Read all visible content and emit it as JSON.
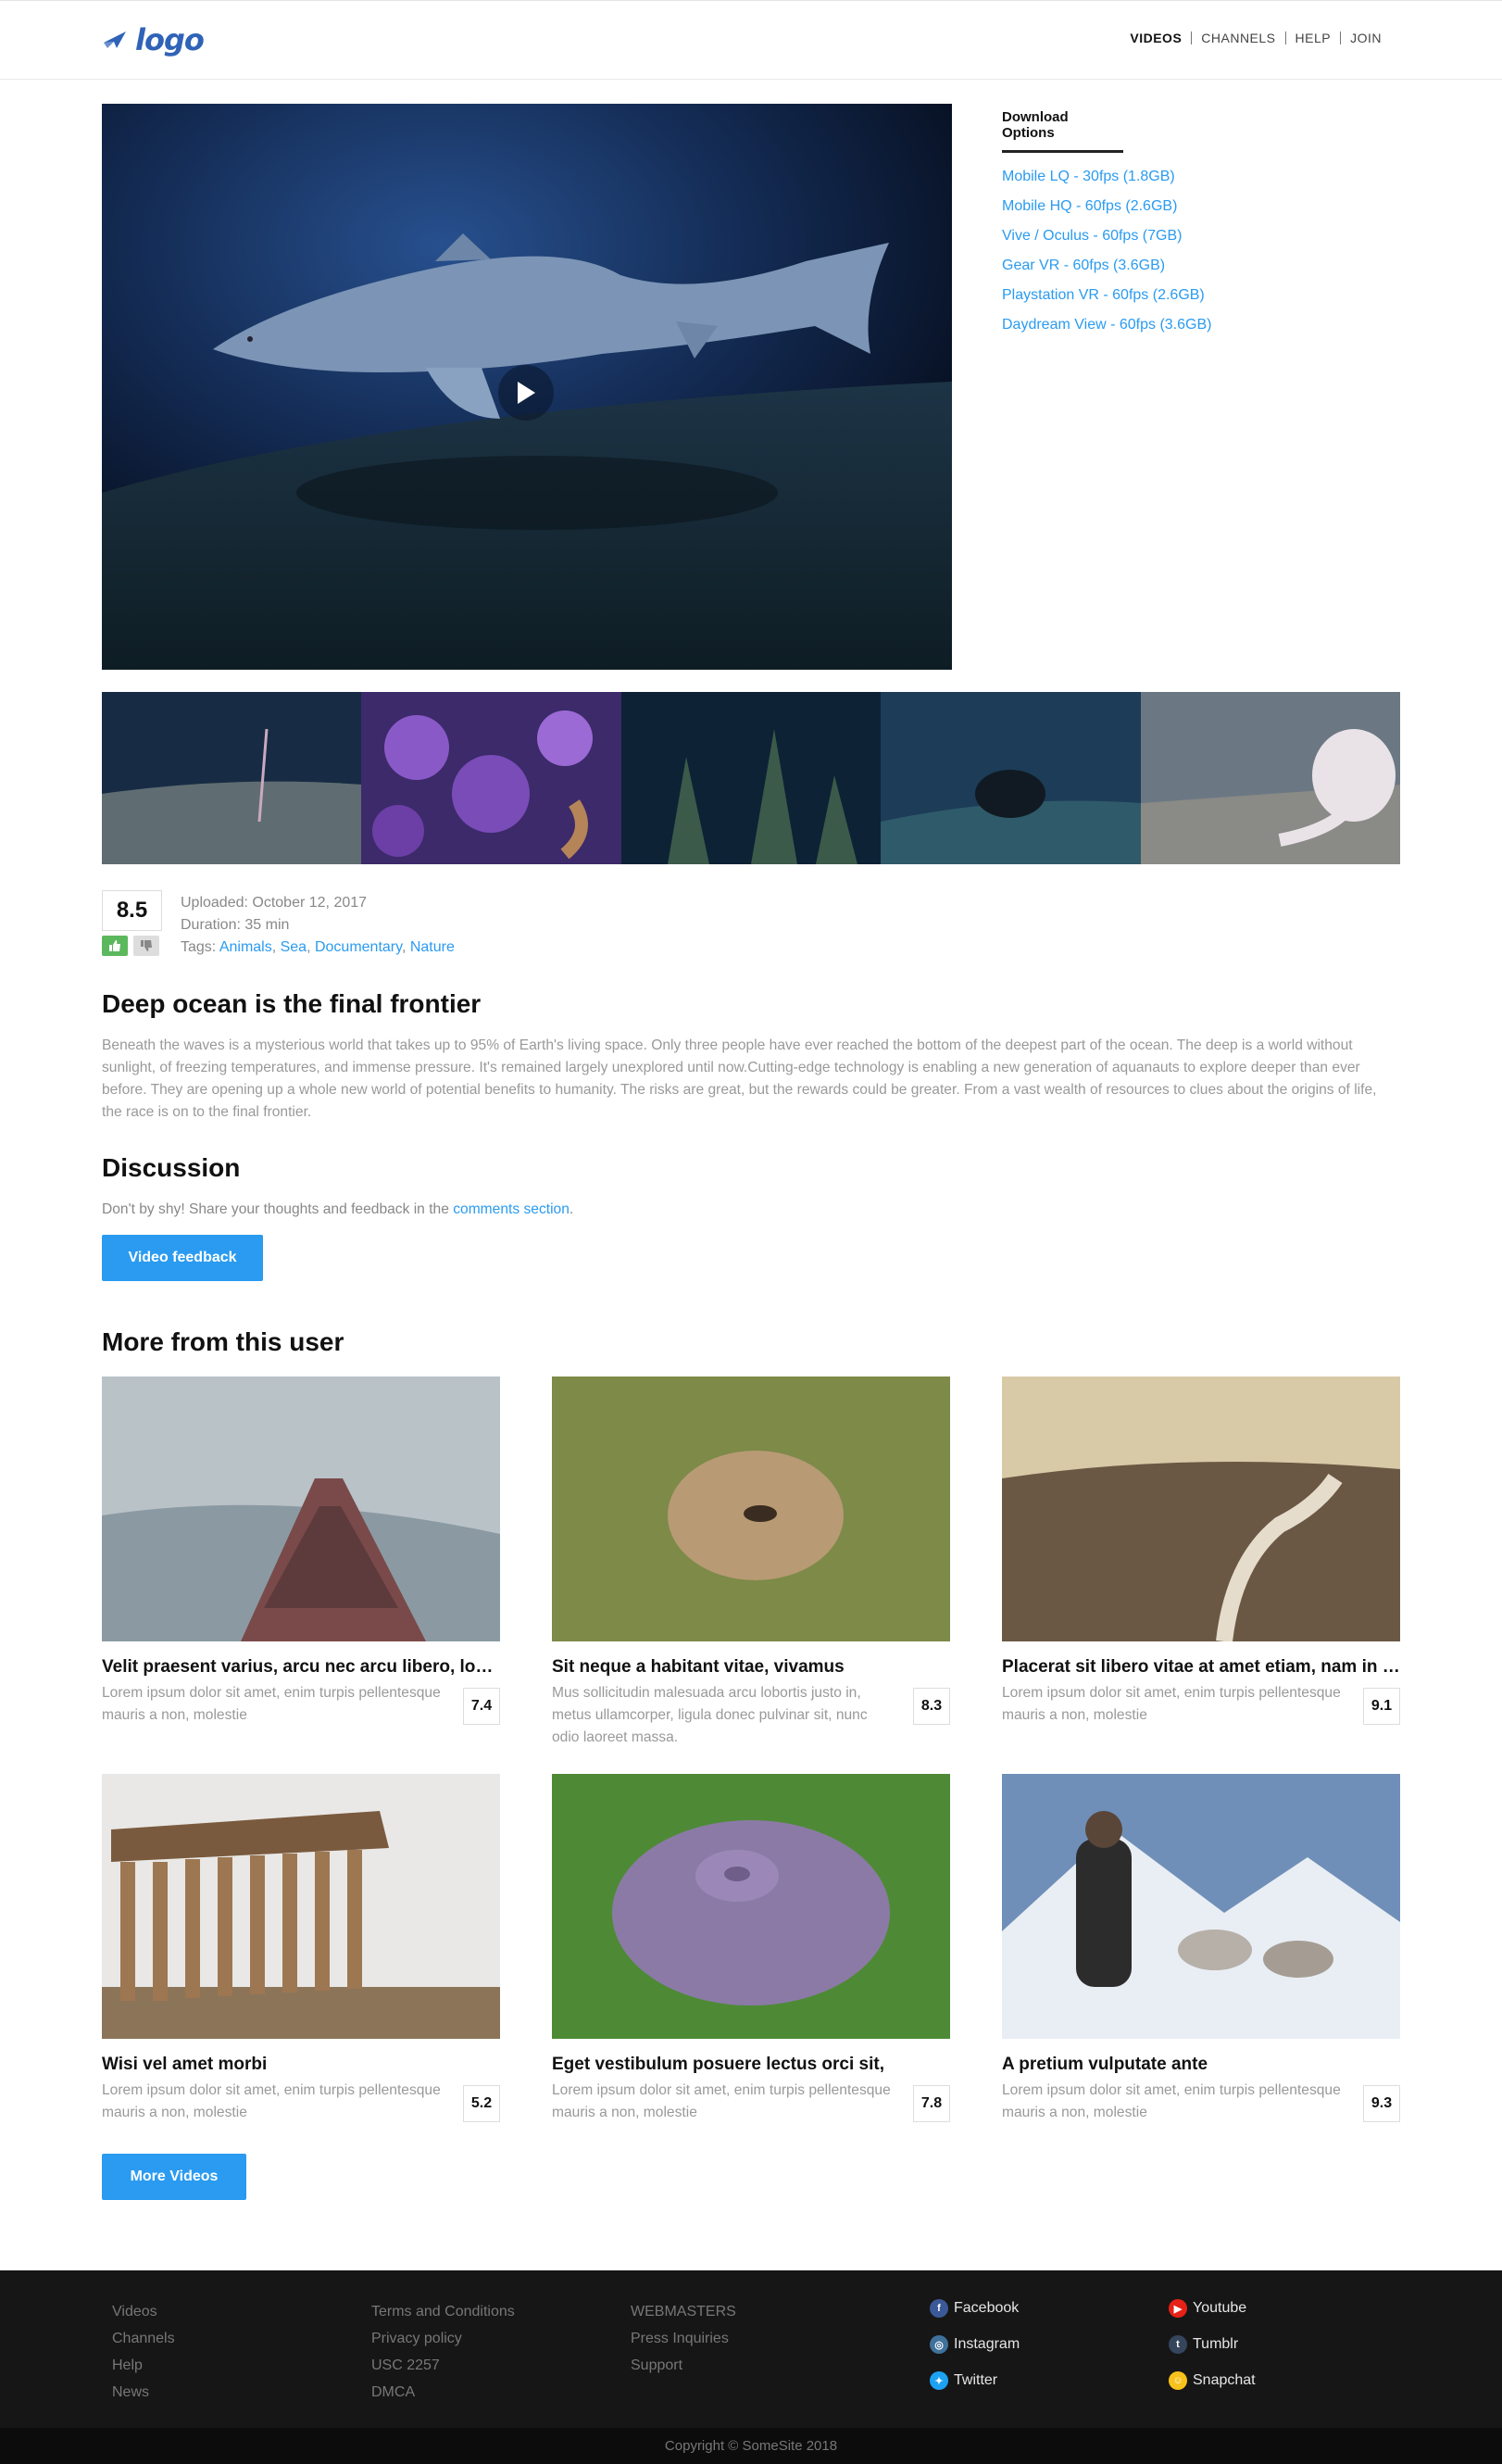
{
  "header": {
    "logo_text": "logo",
    "nav": [
      "VIDEOS",
      "CHANNELS",
      "HELP",
      "JOIN"
    ]
  },
  "download": {
    "title": "Download Options",
    "options": [
      "Mobile LQ - 30fps (1.8GB)",
      "Mobile HQ - 60fps (2.6GB)",
      "Vive / Oculus - 60fps (7GB)",
      "Gear VR - 60fps (3.6GB)",
      "Playstation VR - 60fps (2.6GB)",
      "Daydream View - 60fps (3.6GB)"
    ]
  },
  "video": {
    "rating": "8.5",
    "uploaded": "Uploaded: October 12, 2017",
    "duration": "Duration: 35 min",
    "tags_label": "Tags:",
    "tags": [
      "Animals",
      "Sea",
      "Documentary",
      "Nature"
    ],
    "title": "Deep ocean is the final frontier",
    "description": "Beneath the waves is a mysterious world that takes up to 95% of Earth's living space. Only three people have ever reached the bottom of the deepest part of the ocean. The deep is a world without sunlight, of freezing temperatures, and immense pressure. It's remained largely unexplored until now.Cutting-edge technology is enabling a new generation of aquanauts to explore deeper than ever before. They are opening up a whole new world of potential benefits to humanity. The risks are great, but the rewards could be greater. From a vast wealth of resources to clues about the origins of life, the race is on to the final frontier."
  },
  "discussion": {
    "title": "Discussion",
    "text": "Don't by shy! Share your thoughts and feedback in the",
    "link": "comments section",
    "period": ".",
    "button": "Video feedback"
  },
  "more": {
    "title": "More from this user",
    "button": "More Videos",
    "cards": [
      {
        "title": "Velit praesent varius, arcu nec arcu libero, lobortis",
        "desc": "Lorem ipsum dolor sit amet, enim turpis pellentesque mauris a non, molestie",
        "score": "7.4"
      },
      {
        "title": "Sit neque a habitant vitae, vivamus",
        "desc": "Mus sollicitudin malesuada arcu lobortis justo in, metus ullamcorper, ligula donec pulvinar sit, nunc odio laoreet massa.",
        "score": "8.3"
      },
      {
        "title": "Placerat sit libero vitae at amet etiam, nam in nunc",
        "desc": "Lorem ipsum dolor sit amet, enim turpis pellentesque mauris a non, molestie",
        "score": "9.1"
      },
      {
        "title": "Wisi vel amet morbi",
        "desc": "Lorem ipsum dolor sit amet, enim turpis pellentesque mauris a non, molestie",
        "score": "5.2"
      },
      {
        "title": "Eget vestibulum posuere lectus orci sit,",
        "desc": "Lorem ipsum dolor sit amet, enim turpis pellentesque mauris a non, molestie",
        "score": "7.8"
      },
      {
        "title": "A pretium vulputate ante",
        "desc": "Lorem ipsum dolor sit amet, enim turpis pellentesque mauris a non, molestie",
        "score": "9.3"
      }
    ]
  },
  "footer": {
    "col1": [
      "Videos",
      "Channels",
      "Help",
      "News"
    ],
    "col2": [
      "Terms and Conditions",
      "Privacy policy",
      "USC 2257",
      "DMCA"
    ],
    "col3": [
      "WEBMASTERS",
      "Press Inquiries",
      "Support"
    ],
    "social": [
      {
        "name": "Facebook",
        "icon": "facebook-icon",
        "color": "#3b5998"
      },
      {
        "name": "Youtube",
        "icon": "youtube-icon",
        "color": "#e62117"
      },
      {
        "name": "Instagram",
        "icon": "instagram-icon",
        "color": "#3f729b"
      },
      {
        "name": "Tumblr",
        "icon": "tumblr-icon",
        "color": "#35465c"
      },
      {
        "name": "Twitter",
        "icon": "twitter-icon",
        "color": "#1da1f2"
      },
      {
        "name": "Snapchat",
        "icon": "snapchat-icon",
        "color": "#f7c21b"
      }
    ],
    "copyright": "Copyright © SomeSite 2018"
  },
  "colors": {
    "accent": "#2a9bf0",
    "footer_bg": "#161616",
    "like": "#5cb85c"
  }
}
